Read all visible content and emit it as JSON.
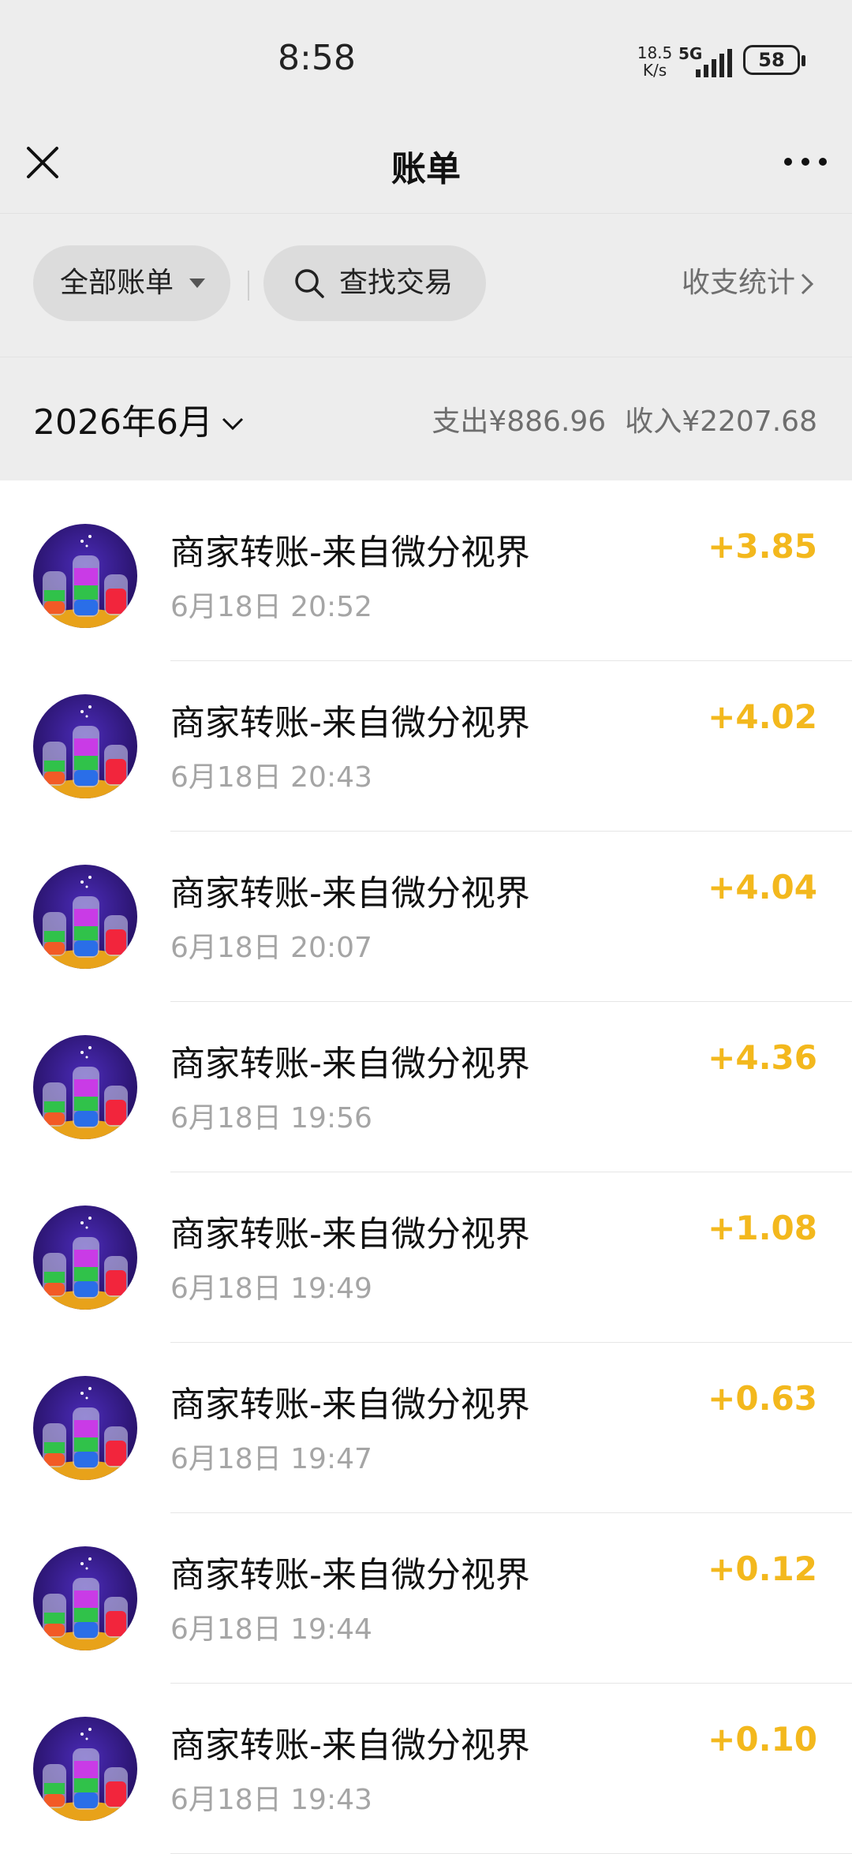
{
  "status_bar": {
    "time": "8:58",
    "net_speed_value": "18.5",
    "net_speed_unit": "K/s",
    "network": "5G",
    "battery": "58"
  },
  "header": {
    "title": "账单",
    "close_icon": "close-icon",
    "more_icon": "more-icon"
  },
  "filters": {
    "all_bills_label": "全部账单",
    "search_label": "查找交易",
    "stats_label": "收支统计"
  },
  "month": {
    "label": "2026年6月",
    "expense_label": "支出",
    "expense_value": "¥886.96",
    "income_label": "收入",
    "income_value": "¥2207.68"
  },
  "colors": {
    "accent_amount": "#f3b81d",
    "background_bar": "#ededed"
  },
  "transactions": [
    {
      "title": "商家转账-来自微分视界",
      "date": "6月18日 20:52",
      "amount": "+3.85"
    },
    {
      "title": "商家转账-来自微分视界",
      "date": "6月18日 20:43",
      "amount": "+4.02"
    },
    {
      "title": "商家转账-来自微分视界",
      "date": "6月18日 20:07",
      "amount": "+4.04"
    },
    {
      "title": "商家转账-来自微分视界",
      "date": "6月18日 19:56",
      "amount": "+4.36"
    },
    {
      "title": "商家转账-来自微分视界",
      "date": "6月18日 19:49",
      "amount": "+1.08"
    },
    {
      "title": "商家转账-来自微分视界",
      "date": "6月18日 19:47",
      "amount": "+0.63"
    },
    {
      "title": "商家转账-来自微分视界",
      "date": "6月18日 19:44",
      "amount": "+0.12"
    },
    {
      "title": "商家转账-来自微分视界",
      "date": "6月18日 19:43",
      "amount": "+0.10"
    }
  ]
}
